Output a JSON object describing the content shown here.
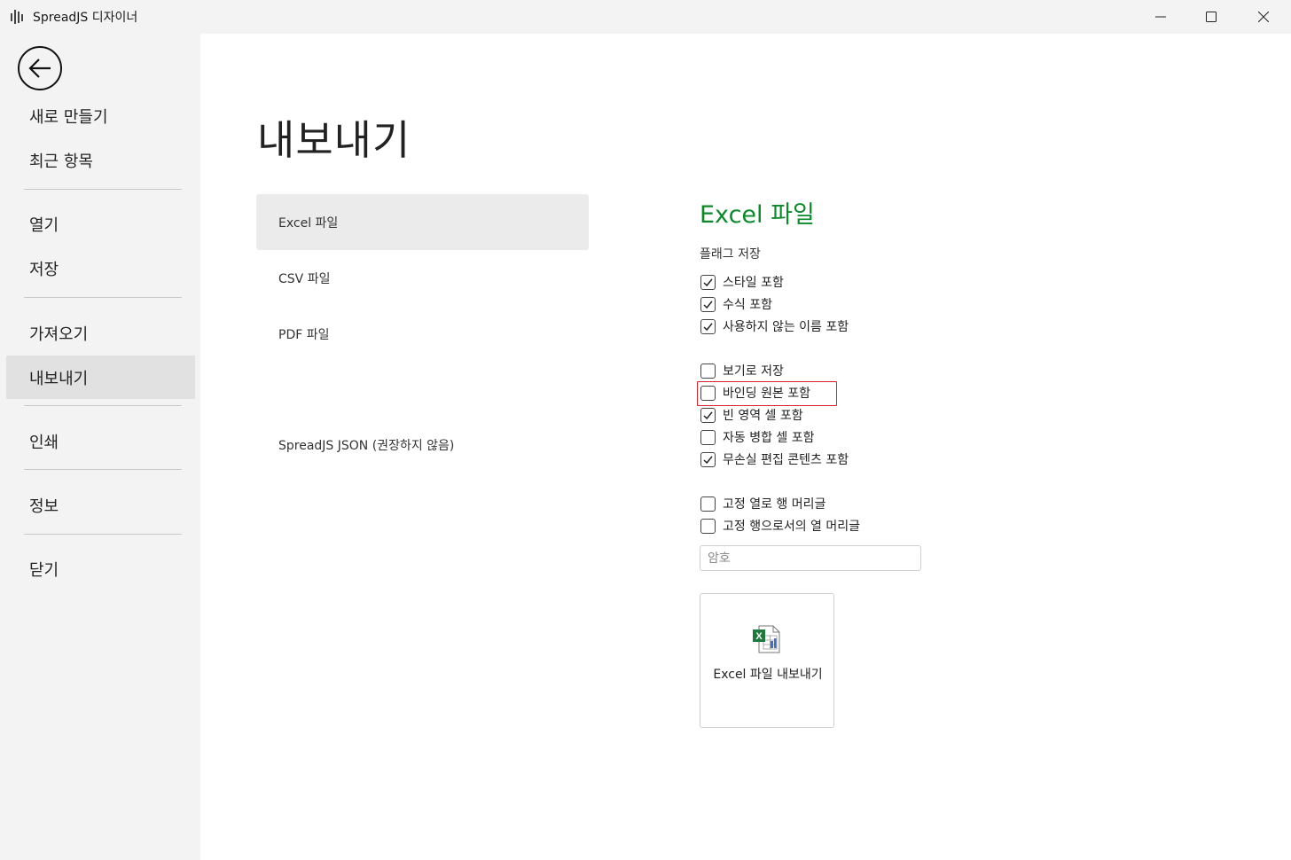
{
  "window": {
    "title": "SpreadJS 디자이너",
    "app_icon": "spreadjs-logo-icon",
    "controls": [
      "minimize-icon",
      "maximize-icon",
      "close-icon"
    ]
  },
  "sidebar": {
    "back_icon": "arrow-left-icon",
    "items": [
      {
        "label": "새로 만들기",
        "active": false
      },
      {
        "label": "최근 항목",
        "active": false
      },
      {
        "label": "열기",
        "active": false
      },
      {
        "label": "저장",
        "active": false
      },
      {
        "label": "가져오기",
        "active": false
      },
      {
        "label": "내보내기",
        "active": true
      },
      {
        "label": "인쇄",
        "active": false
      },
      {
        "label": "정보",
        "active": false
      },
      {
        "label": "닫기",
        "active": false
      }
    ]
  },
  "main": {
    "page_title": "내보내기",
    "formats": [
      {
        "label": "Excel 파일",
        "active": true
      },
      {
        "label": "CSV 파일",
        "active": false
      },
      {
        "label": "PDF 파일",
        "active": false
      },
      {
        "label": "SpreadJS JSON (권장하지 않음)",
        "active": false
      }
    ],
    "panel": {
      "title": "Excel 파일",
      "title_color": "#0a8a2a",
      "flags_label": "플래그 저장",
      "options": [
        {
          "label": "스타일 포함",
          "checked": true
        },
        {
          "label": "수식 포함",
          "checked": true
        },
        {
          "label": "사용하지 않는 이름 포함",
          "checked": true
        },
        {
          "label": "보기로 저장",
          "checked": false
        },
        {
          "label": "바인딩 원본 포함",
          "checked": false,
          "highlighted": true
        },
        {
          "label": "빈 영역 셀 포함",
          "checked": true
        },
        {
          "label": "자동 병합 셀 포함",
          "checked": false
        },
        {
          "label": "무손실 편집 콘텐츠 포함",
          "checked": true
        },
        {
          "label": "고정 열로 행 머리글",
          "checked": false
        },
        {
          "label": "고정 행으로서의 열 머리글",
          "checked": false
        }
      ],
      "password_placeholder": "암호",
      "password_value": "",
      "export_button_label": "Excel 파일 내보내기",
      "export_icon": "excel-file-icon",
      "highlight_color": "#d9232e"
    }
  }
}
